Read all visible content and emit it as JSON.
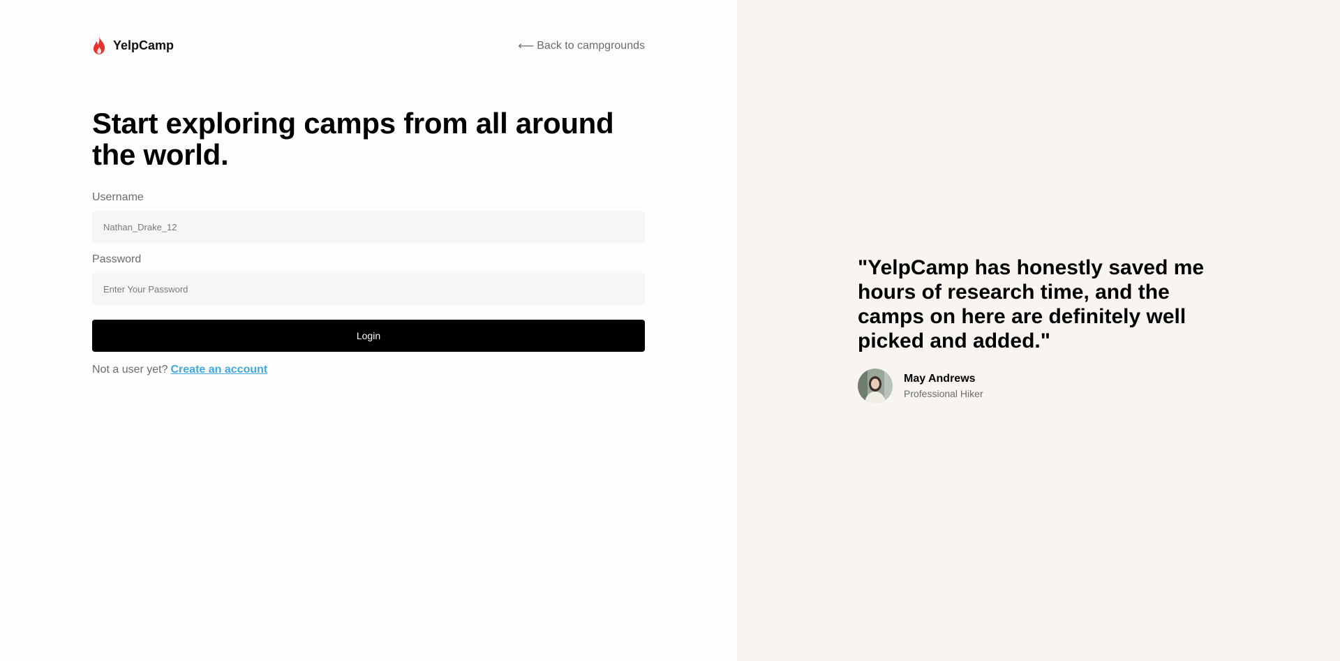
{
  "brand": {
    "name": "YelpCamp",
    "icon": "flame-icon",
    "accent_color": "#e8332d"
  },
  "nav": {
    "back_arrow": "⟵",
    "back_label": "Back to campgrounds"
  },
  "login": {
    "title": "Start exploring camps from all around the world.",
    "username_label": "Username",
    "username_placeholder": "Nathan_Drake_12",
    "password_label": "Password",
    "password_placeholder": "Enter Your Password",
    "submit_label": "Login",
    "signup_prompt": "Not a user yet?",
    "signup_link": "Create an account",
    "link_color": "#3fa9e0"
  },
  "testimonial": {
    "quote": "\"YelpCamp has honestly saved me hours of research time, and the camps on here are definitely well picked and added.\"",
    "author_name": "May Andrews",
    "author_role": "Professional Hiker",
    "avatar_icon": "user-avatar"
  }
}
